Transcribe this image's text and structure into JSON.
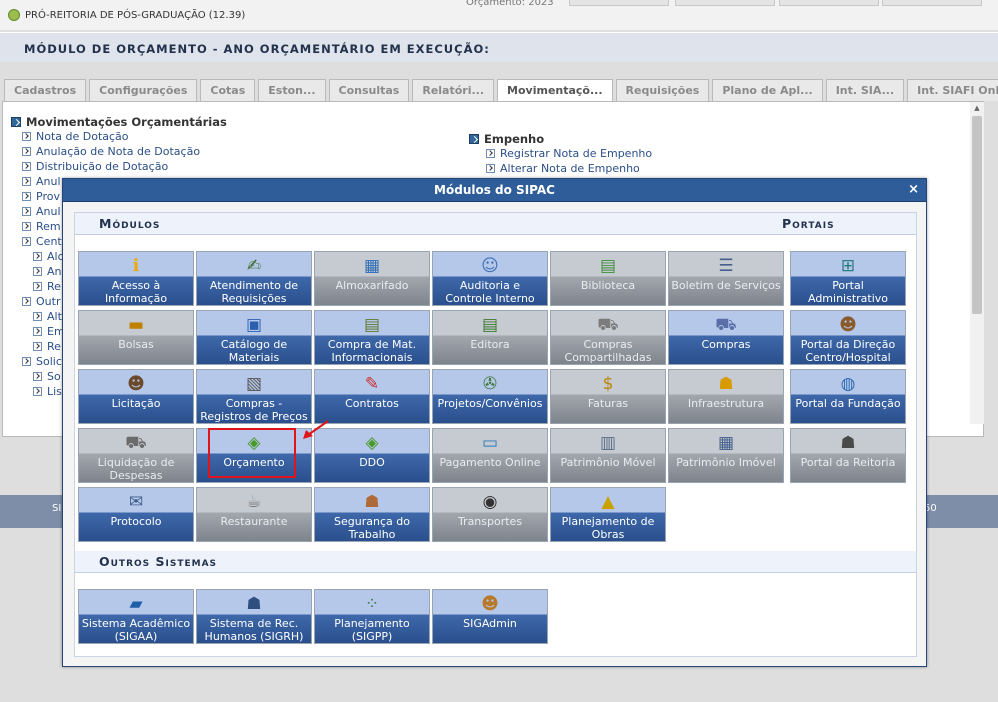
{
  "page": {
    "org_unit": "PRÓ-REITORIA DE PÓS-GRADUAÇÃO (12.39)",
    "orcamento_partial": "Orçamento: 2023",
    "module_title": "MÓDULO DE ORÇAMENTO - ANO ORÇAMENTÁRIO EM EXECUÇÃO:",
    "tabs": [
      "Cadastros",
      "Configurações",
      "Cotas",
      "Eston...",
      "Consultas",
      "Relatóri...",
      "Movimentaçõ...",
      "Requisições",
      "Plano de Apl...",
      "Int. SIA...",
      "Int. SIAFI Onli..."
    ],
    "active_tab": "Movimentaçõ...",
    "left_section": {
      "title": "Movimentações Orçamentárias",
      "links": [
        "Nota de Dotação",
        "Anulação de Nota de Dotação",
        "Distribuição de Dotação",
        "Anul",
        "Prov",
        "Anul",
        "Rem"
      ],
      "group": "Cent",
      "sub_links": [
        "Alo",
        "An",
        "Re"
      ],
      "group2": "Outr",
      "sub_links2": [
        "Alt",
        "Em",
        "Re"
      ],
      "group3": "Solic",
      "sub_links3": [
        "So",
        "Lis"
      ]
    },
    "right_section": {
      "title": "Empenho",
      "links": [
        "Registrar Nota de Empenho",
        "Alterar Nota de Empenho"
      ]
    },
    "footer_left": "SI",
    "footer_right": "50"
  },
  "modal": {
    "title": "Módulos do SIPAC",
    "close": "×",
    "modules_header": "Módulos",
    "portals_header": "Portais",
    "others_header": "Outros Sistemas",
    "rows": [
      [
        {
          "label": "Acesso à Informação",
          "icon": "info-icon",
          "glyph": "ℹ",
          "color": "#f0a800",
          "active": true
        },
        {
          "label": "Atendimento de Requisições",
          "icon": "request-icon",
          "glyph": "✍",
          "color": "#3a6d2c",
          "active": true
        },
        {
          "label": "Almoxarifado",
          "icon": "boxes-icon",
          "glyph": "▦",
          "color": "#2b6bb5",
          "active": false
        },
        {
          "label": "Auditoria e Controle Interno",
          "icon": "audit-icon",
          "glyph": "☺",
          "color": "#3f6fb8",
          "active": true
        },
        {
          "label": "Biblioteca",
          "icon": "books-icon",
          "glyph": "▤",
          "color": "#3e8d3a",
          "active": false
        },
        {
          "label": "Boletim de Serviços",
          "icon": "bulletin-icon",
          "glyph": "☰",
          "color": "#46608a",
          "active": false
        },
        {
          "label": "Portal Administrativo",
          "icon": "network-icon",
          "glyph": "⊞",
          "color": "#2a7a7e",
          "active": true
        }
      ],
      [
        {
          "label": "Bolsas",
          "icon": "folder-icon",
          "glyph": "▬",
          "color": "#c08000",
          "active": false
        },
        {
          "label": "Catálogo de Materiais",
          "icon": "catalog-icon",
          "glyph": "▣",
          "color": "#2a5fb0",
          "active": true
        },
        {
          "label": "Compra de Mat. Informacionais",
          "icon": "purchase-books-icon",
          "glyph": "▤",
          "color": "#5e7a2e",
          "active": true
        },
        {
          "label": "Editora",
          "icon": "books-stack-icon",
          "glyph": "▤",
          "color": "#3b7a2d",
          "active": false
        },
        {
          "label": "Compras Compartilhadas",
          "icon": "shared-cart-icon",
          "glyph": "⛟",
          "color": "#7c7c7c",
          "active": false
        },
        {
          "label": "Compras",
          "icon": "cart-icon",
          "glyph": "⛟",
          "color": "#5a6ea8",
          "active": true
        },
        {
          "label": "Portal da Direção Centro/Hospital",
          "icon": "people-icon",
          "glyph": "☻",
          "color": "#8a5a2b",
          "active": true
        }
      ],
      [
        {
          "label": "Licitação",
          "icon": "people-icon",
          "glyph": "☻",
          "color": "#6a4a2b",
          "active": true
        },
        {
          "label": "Compras - Registros de Preços",
          "icon": "calculator-icon",
          "glyph": "▧",
          "color": "#555555",
          "active": true
        },
        {
          "label": "Contratos",
          "icon": "contract-icon",
          "glyph": "✎",
          "color": "#c82d2d",
          "active": true
        },
        {
          "label": "Projetos/Convênios",
          "icon": "projects-icon",
          "glyph": "✇",
          "color": "#3e7a3e",
          "active": true
        },
        {
          "label": "Faturas",
          "icon": "invoice-icon",
          "glyph": "$",
          "color": "#b8860b",
          "active": false
        },
        {
          "label": "Infraestrutura",
          "icon": "worker-icon",
          "glyph": "☗",
          "color": "#d99a00",
          "active": false
        },
        {
          "label": "Portal da Fundação",
          "icon": "globe-icon",
          "glyph": "◍",
          "color": "#2e6bb3",
          "active": true
        }
      ],
      [
        {
          "label": "Liquidação de Despesas",
          "icon": "cart-icon",
          "glyph": "⛟",
          "color": "#6b6b6b",
          "active": false
        },
        {
          "label": "Orçamento",
          "icon": "money-icon",
          "glyph": "◈",
          "color": "#4a9a2a",
          "active": true
        },
        {
          "label": "DDO",
          "icon": "money-icon",
          "glyph": "◈",
          "color": "#4a9a2a",
          "active": true
        },
        {
          "label": "Pagamento Online",
          "icon": "payment-icon",
          "glyph": "▭",
          "color": "#2b7bb5",
          "active": false
        },
        {
          "label": "Patrimônio Móvel",
          "icon": "furniture-icon",
          "glyph": "▥",
          "color": "#5a6c88",
          "active": false
        },
        {
          "label": "Patrimônio Imóvel",
          "icon": "building-icon",
          "glyph": "▦",
          "color": "#3e5d8a",
          "active": false
        },
        {
          "label": "Portal da Reitoria",
          "icon": "person-icon",
          "glyph": "☗",
          "color": "#4a4a4a",
          "active": false
        }
      ],
      [
        {
          "label": "Protocolo",
          "icon": "protocol-icon",
          "glyph": "✉",
          "color": "#3e5d8a",
          "active": true
        },
        {
          "label": "Restaurante",
          "icon": "coffee-icon",
          "glyph": "☕",
          "color": "#7a7a7a",
          "active": false
        },
        {
          "label": "Segurança do Trabalho",
          "icon": "safety-icon",
          "glyph": "☗",
          "color": "#b06a3a",
          "active": true
        },
        {
          "label": "Transportes",
          "icon": "wheel-icon",
          "glyph": "◉",
          "color": "#333333",
          "active": false
        },
        {
          "label": "Planejamento de Obras",
          "icon": "construction-icon",
          "glyph": "▲",
          "color": "#c9a200",
          "active": true
        }
      ]
    ],
    "others": [
      {
        "label": "Sistema Acadêmico (SIGAA)",
        "icon": "book-icon",
        "glyph": "▰",
        "color": "#1f5fa8",
        "active": true
      },
      {
        "label": "Sistema de Rec. Humanos (SIGRH)",
        "icon": "person-icon",
        "glyph": "☗",
        "color": "#2f4f80",
        "active": true
      },
      {
        "label": "Planejamento (SIGPP)",
        "icon": "diagram-icon",
        "glyph": "⁘",
        "color": "#3a7a4a",
        "active": true
      },
      {
        "label": "SIGAdmin",
        "icon": "admin-icon",
        "glyph": "☻",
        "color": "#b87a2a",
        "active": true
      }
    ]
  }
}
